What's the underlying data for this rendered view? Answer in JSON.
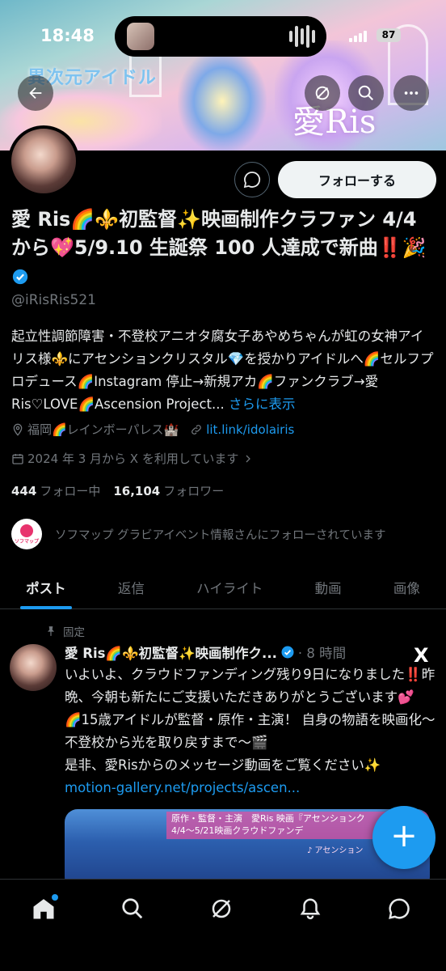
{
  "status_bar": {
    "time": "18:48",
    "battery": "87"
  },
  "banner": {
    "caption": "異次元アイドル",
    "logo_text": "愛Ris"
  },
  "profile": {
    "follow_label": "フォローする",
    "display_name": "愛 Ris🌈⚜️初監督✨映画制作クラファン 4/4 から💖5/9.10 生誕祭 100 人達成で新曲‼️🎉",
    "handle": "@iRisRis521",
    "bio": "起立性調節障害・不登校アニオタ腐女子あやめちゃんが虹の女神アイリス様⚜️にアセンションクリスタル💎を授かりアイドルへ🌈セルフプロデュース🌈Instagram 停止→新規アカ🌈ファンクラブ→愛 Ris♡LOVE🌈Ascension Project...",
    "bio_more": "さらに表示",
    "location": "福岡🌈レインボーパレス🏰",
    "link": "lit.link/idolairis",
    "joined": "2024 年 3 月から X を利用しています",
    "following_count": "444",
    "following_label": "フォロー中",
    "followers_count": "16,104",
    "followers_label": "フォロワー",
    "followed_by_avatar_text": "ソフマップ",
    "followed_by_text": "ソフマップ グラビアイベント情報さんにフォローされています"
  },
  "tabs": [
    {
      "label": "ポスト",
      "active": true
    },
    {
      "label": "返信",
      "active": false
    },
    {
      "label": "ハイライト",
      "active": false
    },
    {
      "label": "動画",
      "active": false
    },
    {
      "label": "画像",
      "active": false
    }
  ],
  "pinned_post": {
    "pinned_label": "固定",
    "author": "愛 Ris🌈⚜️初監督✨映画制作ク...",
    "time": "· 8 時間",
    "x_logo": "X",
    "lines": [
      "いよいよ、クラウドファンディング残り9日になりました‼️昨晩、今朝も新たにご支援いただきありがとうございます💕",
      "🌈15歳アイドルが監督・原作・主演！ 自身の物語を映画化〜不登校から光を取り戻すまで〜🎬",
      "是非、愛Risからのメッセージ動画をご覧ください✨"
    ],
    "link": "motion-gallery.net/projects/ascen...",
    "media_band_line1": "原作・監督・主演　愛Ris  映画『アセンションク",
    "media_band_line2": "4/4〜5/21映画クラウドファンデ",
    "media_ribbon": "♪ アセンション"
  },
  "fab_label": "+",
  "colors": {
    "accent": "#1d9bf0",
    "background": "#000000",
    "text": "#e7e9ea",
    "muted": "#71767b"
  }
}
